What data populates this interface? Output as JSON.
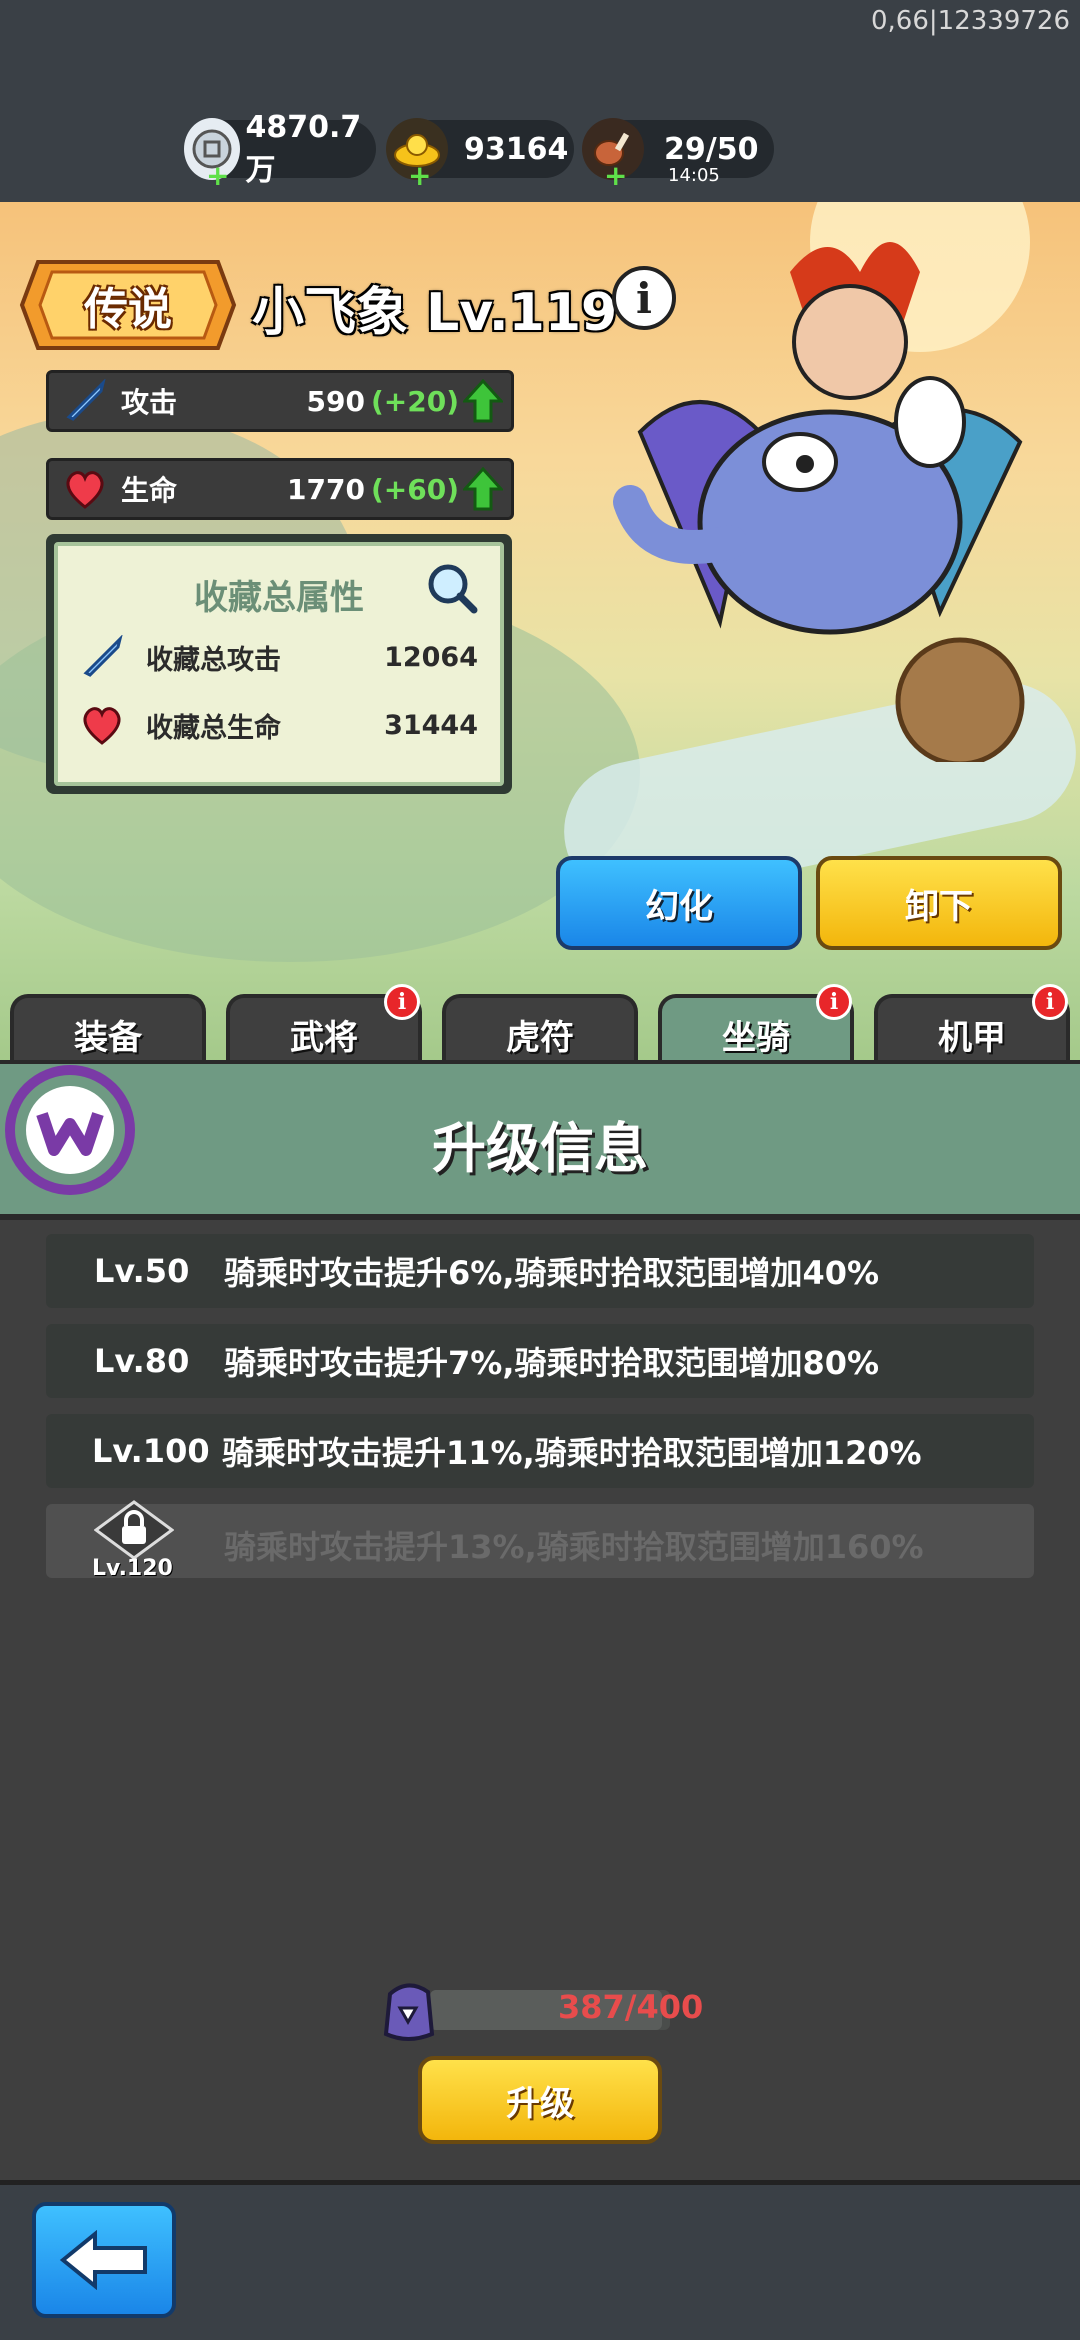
{
  "status": {
    "build_id": "0,66|12339726"
  },
  "resources": [
    {
      "icon": "silver-coin-icon",
      "value": "4870.7万"
    },
    {
      "icon": "gold-ingot-icon",
      "value": "93164"
    },
    {
      "icon": "meat-stamina-icon",
      "value": "29/50",
      "timer": "14:05"
    }
  ],
  "mount": {
    "rarity": "传说",
    "name": "小飞象 Lv.119",
    "stats": [
      {
        "label": "攻击",
        "value": "590",
        "bonus": "(+20)",
        "icon": "sword-icon"
      },
      {
        "label": "生命",
        "value": "1770",
        "bonus": "(+60)",
        "icon": "heart-icon"
      }
    ],
    "collection": {
      "title": "收藏总属性",
      "rows": [
        {
          "label": "收藏总攻击",
          "value": "12064",
          "icon": "sword-icon"
        },
        {
          "label": "收藏总生命",
          "value": "31444",
          "icon": "heart-icon"
        }
      ]
    },
    "buttons": {
      "transform": "幻化",
      "unequip": "卸下"
    }
  },
  "tabs": [
    {
      "label": "装备",
      "badge": false,
      "active": false
    },
    {
      "label": "武将",
      "badge": true,
      "active": false
    },
    {
      "label": "虎符",
      "badge": false,
      "active": false
    },
    {
      "label": "坐骑",
      "badge": true,
      "active": true
    },
    {
      "label": "机甲",
      "badge": true,
      "active": false
    }
  ],
  "badge_glyph": "i",
  "upgrade": {
    "title": "升级信息",
    "levels": [
      {
        "level": "Lv.50",
        "desc": "骑乘时攻击提升6%,骑乘时拾取范围增加40%",
        "locked": false
      },
      {
        "level": "Lv.80",
        "desc": "骑乘时攻击提升7%,骑乘时拾取范围增加80%",
        "locked": false
      },
      {
        "level": "Lv.100",
        "desc": "骑乘时攻击提升11%,骑乘时拾取范围增加120%",
        "locked": false
      },
      {
        "level": "Lv.120",
        "desc": "骑乘时攻击提升13%,骑乘时拾取范围增加160%",
        "locked": true
      }
    ],
    "material": "387/400",
    "material_progress": 0.9675,
    "button": "升级"
  },
  "colors": {
    "accent_green": "#6f9a83",
    "bonus_green": "#6fe05a",
    "warn_red": "#e84c4c"
  }
}
